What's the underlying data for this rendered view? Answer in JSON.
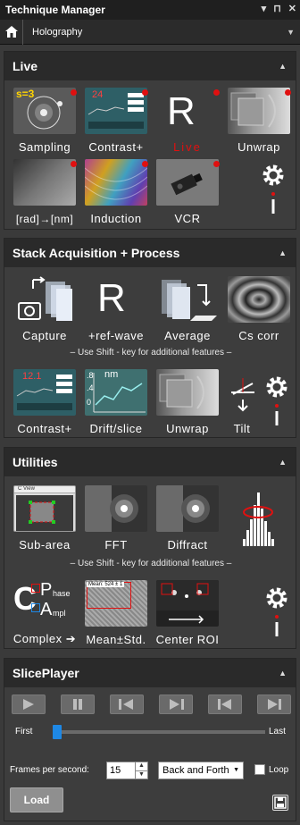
{
  "window": {
    "title": "Technique Manager",
    "controls": [
      "▾",
      "⊓",
      "✕"
    ]
  },
  "breadcrumb": {
    "current": "Holography"
  },
  "live": {
    "title": "Live",
    "tiles": [
      {
        "label": "Sampling",
        "overlay": "s=3",
        "dot": true
      },
      {
        "label": "Contrast+",
        "overlay": "24",
        "dot": true
      },
      {
        "label": "Live",
        "big_letter": "R",
        "dot": true
      },
      {
        "label": "Unwrap",
        "dot": true
      },
      {
        "label": "[rad]→[nm]",
        "dot": true
      },
      {
        "label": "Induction",
        "dot": true
      },
      {
        "label": "VCR",
        "dot": true
      }
    ]
  },
  "stack": {
    "title": "Stack Acquisition + Process",
    "row1": [
      {
        "label": "Capture"
      },
      {
        "label": "+ref-wave",
        "big_letter": "R"
      },
      {
        "label": "Average"
      },
      {
        "label": "Cs corr"
      }
    ],
    "hint": "–  Use  Shift - key  for additional features  –",
    "row2": [
      {
        "label": "Contrast+",
        "overlay": "12.1"
      },
      {
        "label": "Drift/slice",
        "overlay": "nm",
        "ticks": [
          ".8",
          ".4",
          "0"
        ]
      },
      {
        "label": "Unwrap"
      },
      {
        "label": "Tilt"
      }
    ]
  },
  "utilities": {
    "title": "Utilities",
    "row1": [
      {
        "label": "Sub-area",
        "window_title": "C View"
      },
      {
        "label": "FFT"
      },
      {
        "label": "Diffract"
      },
      {
        "label": ""
      }
    ],
    "hint": "–  Use  Shift - key  for additional features  –",
    "row2": [
      {
        "label": "Complex",
        "letters": [
          "C",
          "P",
          "hase",
          "A",
          "mpl"
        ]
      },
      {
        "label": "Mean±Std.",
        "overlay": "Mean: 524 ± 1"
      },
      {
        "label": "Center ROI"
      }
    ]
  },
  "sliceplayer": {
    "title": "SlicePlayer",
    "first_label": "First",
    "last_label": "Last",
    "slider_fraction": 0.0,
    "fps_label": "Frames per second:",
    "fps_value": "15",
    "mode": "Back and Forth",
    "loop_label": "Loop",
    "loop_checked": false,
    "load_label": "Load"
  },
  "colors": {
    "accent": "#1e88e5",
    "live_red": "#e01010",
    "panel": "#3d3d3d",
    "header": "#2a2a2a"
  }
}
